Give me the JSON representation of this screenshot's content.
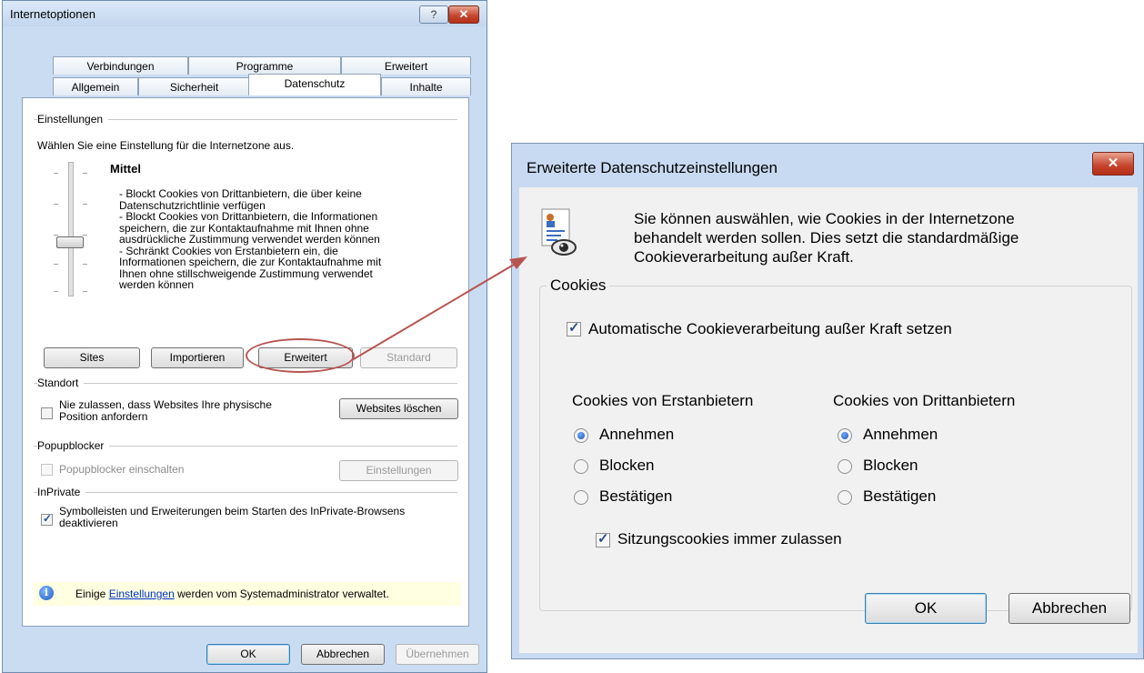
{
  "left_dialog": {
    "title": "Internetoptionen",
    "help_glyph": "?",
    "close_glyph": "✕",
    "tabs_row1": [
      "Verbindungen",
      "Programme",
      "Erweitert"
    ],
    "tabs_row2": [
      "Allgemein",
      "Sicherheit",
      "Datenschutz",
      "Inhalte"
    ],
    "active_tab": "Datenschutz",
    "settings": {
      "group_label": "Einstellungen",
      "prompt": "Wählen Sie eine Einstellung für die Internetzone aus.",
      "level_title": "Mittel",
      "level_description": [
        "- Blockt Cookies von Drittanbietern, die über keine",
        "Datenschutzrichtlinie verfügen",
        "- Blockt Cookies von Drittanbietern, die Informationen",
        "speichern, die zur Kontaktaufnahme mit Ihnen ohne",
        "ausdrückliche Zustimmung verwendet werden können",
        "- Schränkt Cookies von Erstanbietern ein, die",
        "Informationen speichern, die zur Kontaktaufnahme mit",
        "Ihnen ohne stillschweigende Zustimmung verwendet",
        "werden können"
      ],
      "buttons": {
        "sites": "Sites",
        "import": "Importieren",
        "advanced": "Erweitert",
        "default": "Standard"
      }
    },
    "location": {
      "group_label": "Standort",
      "checkbox_line1": "Nie zulassen, dass Websites Ihre physische",
      "checkbox_line2": "Position anfordern",
      "checked": false,
      "clear_button": "Websites löschen"
    },
    "popup": {
      "group_label": "Popupblocker",
      "checkbox": "Popupblocker einschalten",
      "checked": false,
      "settings_button": "Einstellungen"
    },
    "inprivate": {
      "group_label": "InPrivate",
      "checkbox_line1": "Symbolleisten und Erweiterungen beim Starten des InPrivate-Browsens",
      "checkbox_line2": "deaktivieren",
      "checked": true
    },
    "info": {
      "pre": "Einige ",
      "link": "Einstellungen",
      "post": " werden vom Systemadministrator verwaltet."
    },
    "footer": {
      "ok": "OK",
      "cancel": "Abbrechen",
      "apply": "Übernehmen"
    }
  },
  "right_dialog": {
    "title": "Erweiterte Datenschutzeinstellungen",
    "close_glyph": "✕",
    "intro": [
      "Sie können auswählen, wie Cookies in der Internetzone",
      "behandelt werden sollen. Dies setzt die standardmäßige",
      "Cookieverarbeitung außer Kraft."
    ],
    "group_label": "Cookies",
    "override_checkbox": "Automatische Cookieverarbeitung außer Kraft setzen",
    "override_checked": true,
    "first_party": {
      "label": "Cookies von Erstanbietern",
      "options": [
        "Annehmen",
        "Blocken",
        "Bestätigen"
      ],
      "selected": "Annehmen"
    },
    "third_party": {
      "label": "Cookies von Drittanbietern",
      "options": [
        "Annehmen",
        "Blocken",
        "Bestätigen"
      ],
      "selected": "Annehmen"
    },
    "session_checkbox": "Sitzungscookies immer zulassen",
    "session_checked": true,
    "footer": {
      "ok": "OK",
      "cancel": "Abbrechen"
    }
  },
  "annotation": {
    "color": "#b85450"
  }
}
